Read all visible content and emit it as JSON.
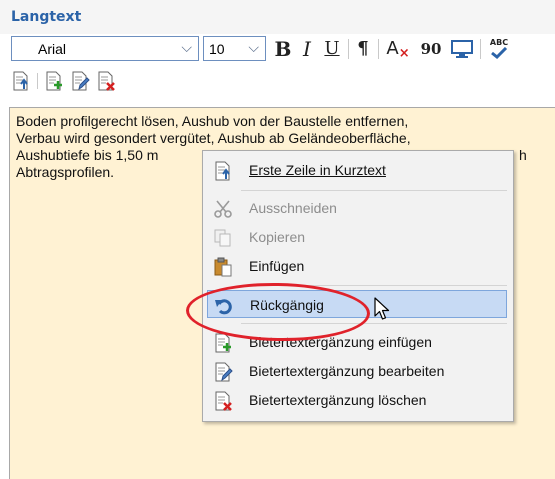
{
  "header": {
    "title": "Langtext"
  },
  "toolbar": {
    "font": "Arial",
    "size": "10",
    "bold": "B",
    "italic": "I",
    "underline": "U",
    "paragraph": "¶",
    "clear_format": "A",
    "rotate": "90",
    "spell": "ABC"
  },
  "editor": {
    "lines": [
      "Boden profilgerecht lösen, Aushub von der Baustelle entfernen,",
      "Verbau wird gesondert vergütet, Aushub ab Geländeoberfläche,",
      "Aushubtiefe bis 1,50 m",
      "Abtragsprofilen."
    ],
    "line3_tail": "h"
  },
  "context_menu": {
    "items": [
      {
        "label": "Erste Zeile in Kurztext",
        "icon": "first-line-to-shorttext-icon",
        "enabled": true
      },
      {
        "label": "Ausschneiden",
        "icon": "scissors-icon",
        "enabled": false
      },
      {
        "label": "Kopieren",
        "icon": "copy-icon",
        "enabled": false
      },
      {
        "label": "Einfügen",
        "icon": "paste-icon",
        "enabled": true
      },
      {
        "label": "Rückgängig",
        "icon": "undo-icon",
        "enabled": true,
        "highlighted": true
      },
      {
        "label": "Bietertextergänzung einfügen",
        "icon": "bidder-text-insert-icon",
        "enabled": true
      },
      {
        "label": "Bietertextergänzung bearbeiten",
        "icon": "bidder-text-edit-icon",
        "enabled": true
      },
      {
        "label": "Bietertextergänzung löschen",
        "icon": "bidder-text-delete-icon",
        "enabled": true
      }
    ]
  },
  "colors": {
    "accent": "#2b63a8",
    "editor_bg": "#fff2d3",
    "highlight": "#c7daf4",
    "annotation": "#e0222b"
  }
}
